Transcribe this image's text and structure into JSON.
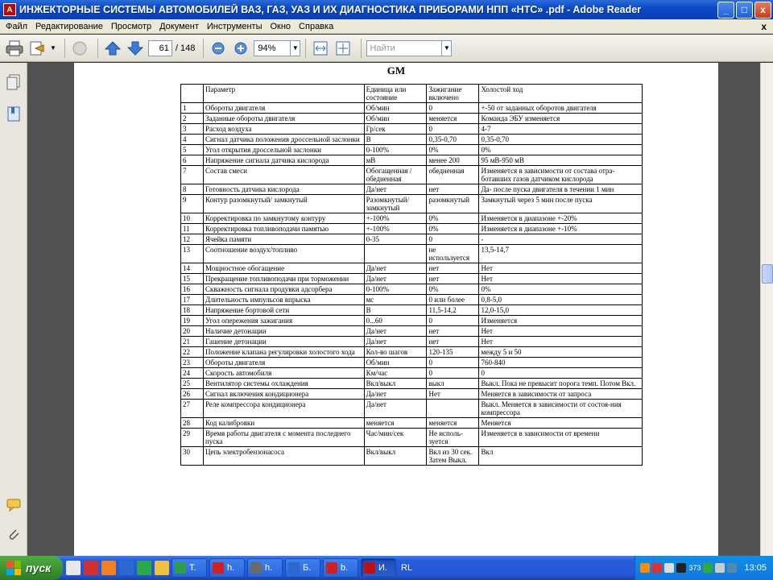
{
  "window": {
    "title": "ИНЖЕКТОРНЫЕ СИСТЕМЫ АВТОМОБИЛЕЙ ВАЗ, ГАЗ, УАЗ И ИХ ДИАГНОСТИКА ПРИБОРАМИ НПП «НТС» .pdf - Adobe Reader",
    "minimize": "_",
    "maximize": "□",
    "close": "x"
  },
  "menu": {
    "items": [
      "Файл",
      "Редактирование",
      "Просмотр",
      "Документ",
      "Инструменты",
      "Окно",
      "Справка"
    ],
    "doc_close": "x"
  },
  "toolbar": {
    "page_current": "61",
    "page_total": "/ 148",
    "zoom": "94%",
    "search_placeholder": "Найти"
  },
  "document": {
    "heading": "GM",
    "table": {
      "headers": [
        "",
        "Параметр",
        "Единица или состояние",
        "Зажигание включено",
        "Холостой ход"
      ],
      "rows": [
        [
          "1",
          "Обороты двигателя",
          "Об/мин",
          "0",
          "+-50 от заданных оборотов двигателя"
        ],
        [
          "2",
          "Заданные обороты двигателя",
          "Об/мин",
          "меняется",
          "Команда ЭБУ изменяется"
        ],
        [
          "3",
          "Расход воздуха",
          "Гр/сек",
          "0",
          "4-7"
        ],
        [
          "4",
          "Сигнал датчика положения дроссельной заслонки",
          "В",
          "0,35-0,70",
          "0,35-0,70"
        ],
        [
          "5",
          "Угол открытия дроссельной заслонки",
          "0-100%",
          "0%",
          "0%"
        ],
        [
          "6",
          "Напряжение сигнала датчика кислорода",
          "мВ",
          "менее 200",
          "95 мВ-950 мВ"
        ],
        [
          "7",
          "Состав смеси",
          "Обогащенная /обедненная",
          "обедненная",
          "Изменяется в зависимости от состава отра-ботавших газов датчиком кислорода"
        ],
        [
          "8",
          "Готовность датчика кислорода",
          "Да/нет",
          "нет",
          "Да- после пуска двигателя в течении 1 мин"
        ],
        [
          "9",
          "Контур разомкнутый/ замкнутый",
          "Разомкнутый/ замкнутый",
          "разомкнутый",
          "Замкнутый через 5 мин после пуска"
        ],
        [
          "10",
          "Корректировка по замкнутому контуру",
          "+-100%",
          "0%",
          "Изменяется в диапазоне +-20%"
        ],
        [
          "11",
          "Корректировка топливоподачи памятью",
          "+-100%",
          "0%",
          "Изменяется в диапазоне +-10%"
        ],
        [
          "12",
          "Ячейка памяти",
          "0-35",
          "0",
          "-"
        ],
        [
          "13",
          "Соотношение воздух/топливо",
          "",
          "не используется",
          "13,5-14,7"
        ],
        [
          "14",
          "Мощностное обогащение",
          "Да/нет",
          "нет",
          "Нет"
        ],
        [
          "15",
          "Прекращение топливоподачи при торможении",
          "Да/нет",
          "нет",
          "Нет"
        ],
        [
          "16",
          "Скважность сигнала продувки адсорбера",
          "0-100%",
          "0%",
          "0%"
        ],
        [
          "17",
          "Длительность импульсов впрыска",
          "мс",
          "0 или более",
          "0,8-5,0"
        ],
        [
          "18",
          "Напряжение бортовой сети",
          "В",
          "11,5-14,2",
          "12,0-15,0"
        ],
        [
          "19",
          "Угол опережения зажигания",
          "0...60",
          "0",
          "Изменяется"
        ],
        [
          "20",
          "Наличие детонации",
          "Да/нет",
          "нет",
          "Нет"
        ],
        [
          "21",
          "Гашение детонации",
          "Да/нет",
          "нет",
          "Нет"
        ],
        [
          "22",
          "Положение клапана регулировки холостого хода",
          "Кол-во шагов",
          "120-135",
          "между 5 и 50"
        ],
        [
          "23",
          "Обороты двигателя",
          "Об/мин",
          "0",
          "760-840"
        ],
        [
          "24",
          "Скорость автомобиля",
          "Км/час",
          "0",
          "0"
        ],
        [
          "25",
          "Вентилятор системы охлаждения",
          "Вкл/выкл",
          "выкл",
          "Выкл. Пока не превысит порога темп. Потом Вкл."
        ],
        [
          "26",
          "Сигнал включения кондиционера",
          "Да/нет",
          "Нет",
          "Меняется в зависимости от запроса"
        ],
        [
          "27",
          "Реле компрессора кондиционера",
          "Да/нет",
          "",
          "Выкл. Меняется в зависимости от состоя-ния компрессора"
        ],
        [
          "28",
          "Код калибровки",
          "меняется",
          "меняется",
          "Меняется"
        ],
        [
          "29",
          "Время работы двигателя с момента последнего пуска",
          "Час/мин/сек",
          "Не исполь-зуется",
          "Изменяется в зависимости от времени"
        ],
        [
          "30",
          "Цепь электробензонасоса",
          "Вкл/выкл",
          "Вкл из 30 сек. Затем Выкл.",
          "Вкл"
        ]
      ]
    }
  },
  "taskbar": {
    "start_label": "пуск",
    "tasks": [
      {
        "label": "Т.",
        "color": "#2f9e44"
      },
      {
        "label": "h.",
        "color": "#d02020"
      },
      {
        "label": "h.",
        "color": "#6a6a6a"
      },
      {
        "label": "Б.",
        "color": "#2a6ad0"
      },
      {
        "label": "b.",
        "color": "#d02020"
      },
      {
        "label": "И.",
        "color": "#c01010"
      }
    ],
    "lang": "RL",
    "tray_number": "373",
    "clock": "13:05"
  }
}
